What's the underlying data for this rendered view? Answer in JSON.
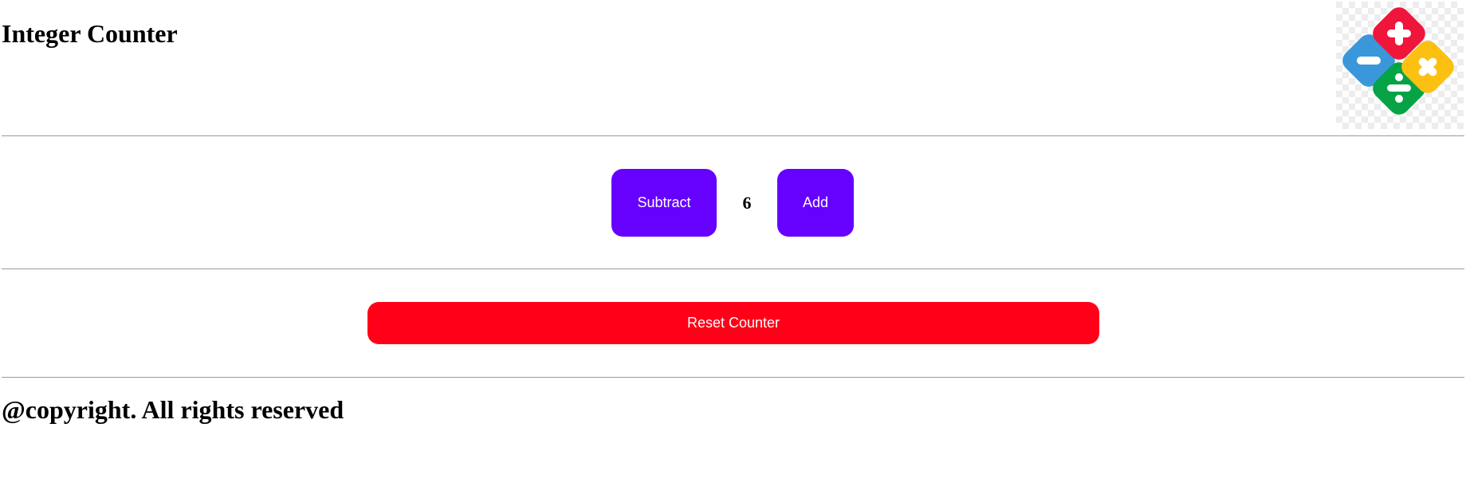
{
  "header": {
    "title": "Integer Counter",
    "logo": {
      "icon": "math-operations-icon",
      "colors": {
        "plus": "#f0153b",
        "minus": "#3a97d9",
        "multiply": "#fbc012",
        "divide": "#06a346"
      }
    }
  },
  "counter": {
    "subtract_label": "Subtract",
    "value": "6",
    "add_label": "Add",
    "button_color": "#6600ff"
  },
  "reset": {
    "label": "Reset Counter",
    "color": "#ff0018"
  },
  "footer": {
    "text": "@copyright. All rights reserved"
  }
}
